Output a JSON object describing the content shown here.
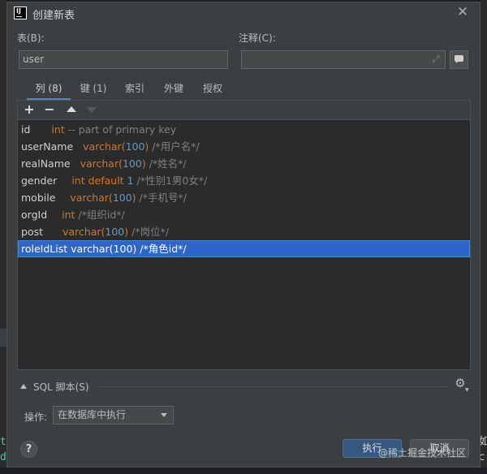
{
  "edge": {
    "left_chars": [
      "t",
      "d"
    ],
    "right_chars": [
      "如",
      "c"
    ]
  },
  "window": {
    "title": "创建新表",
    "app_icon_text": "IJ"
  },
  "form": {
    "table_label": "表(B):",
    "table_value": "user",
    "comment_label": "注释(C):",
    "comment_value": ""
  },
  "tabs": [
    {
      "label": "列 (8)",
      "active": true
    },
    {
      "label": "键 (1)",
      "active": false
    },
    {
      "label": "索引",
      "active": false
    },
    {
      "label": "外键",
      "active": false
    },
    {
      "label": "授权",
      "active": false
    }
  ],
  "toolbar": {
    "add": "+",
    "remove": "−"
  },
  "columns": [
    {
      "name": "id",
      "type": "int",
      "num": "",
      "suffix": "",
      "comment": "-- part of primary key",
      "selected": false
    },
    {
      "name": "userName",
      "type": "varchar(",
      "num": "100",
      "suffix": ")",
      "comment": "/*用户名*/",
      "selected": false
    },
    {
      "name": "realName",
      "type": "varchar(",
      "num": "100",
      "suffix": ")",
      "comment": "/*姓名*/",
      "selected": false
    },
    {
      "name": "gender",
      "type": "int default ",
      "num": "1",
      "suffix": "",
      "comment": "/*性别1男0女*/",
      "selected": false
    },
    {
      "name": "mobile",
      "type": "varchar(",
      "num": "100",
      "suffix": ")",
      "comment": "/*手机号*/",
      "selected": false
    },
    {
      "name": "orgId",
      "type": "int",
      "num": "",
      "suffix": "",
      "comment": "/*组织id*/",
      "selected": false
    },
    {
      "name": "post",
      "type": "varchar(",
      "num": "100",
      "suffix": ")",
      "comment": "/*岗位*/",
      "selected": false
    },
    {
      "name": "roleIdList",
      "type": "varchar(",
      "num": "100",
      "suffix": ")",
      "comment": "/*角色id*/",
      "selected": true
    }
  ],
  "sql": {
    "label": "SQL 脚本(S)"
  },
  "operation": {
    "label": "操作:",
    "selected": "在数据库中执行"
  },
  "buttons": {
    "help": "?",
    "execute": "执行",
    "cancel": "取消"
  },
  "watermark": "@稀土掘金技术社区",
  "colors": {
    "accent": "#4a88c7",
    "selection": "#2f65ca",
    "keyword": "#cc7832",
    "number": "#6897bb",
    "comment": "#808080"
  }
}
